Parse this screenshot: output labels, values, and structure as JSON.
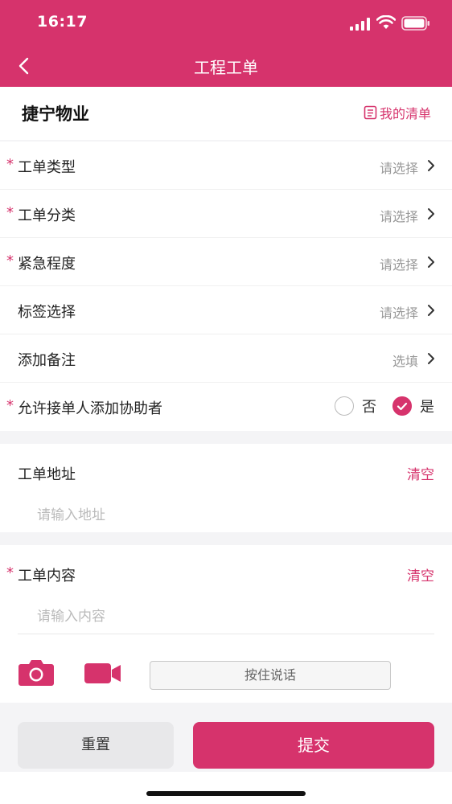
{
  "status": {
    "time": "16:17"
  },
  "nav": {
    "title": "工程工单"
  },
  "company": {
    "name": "捷宁物业",
    "my_list": "我的清单"
  },
  "form": {
    "rows": [
      {
        "label": "工单类型",
        "required": "*",
        "value": "请选择"
      },
      {
        "label": "工单分类",
        "required": "*",
        "value": "请选择"
      },
      {
        "label": "紧急程度",
        "required": "*",
        "value": "请选择"
      },
      {
        "label": "标签选择",
        "required": "",
        "value": "请选择"
      },
      {
        "label": "添加备注",
        "required": "",
        "value": "选填"
      }
    ],
    "assist": {
      "label": "允许接单人添加协助者",
      "required": "*",
      "option_no": "否",
      "option_yes": "是",
      "selected": "是"
    }
  },
  "address": {
    "title": "工单地址",
    "clear": "清空",
    "placeholder": "请输入地址"
  },
  "content": {
    "title": "工单内容",
    "required": "*",
    "clear": "清空",
    "placeholder": "请输入内容",
    "talk": "按住说话"
  },
  "actions": {
    "reset": "重置",
    "submit": "提交"
  },
  "colors": {
    "accent": "#d6336c"
  }
}
